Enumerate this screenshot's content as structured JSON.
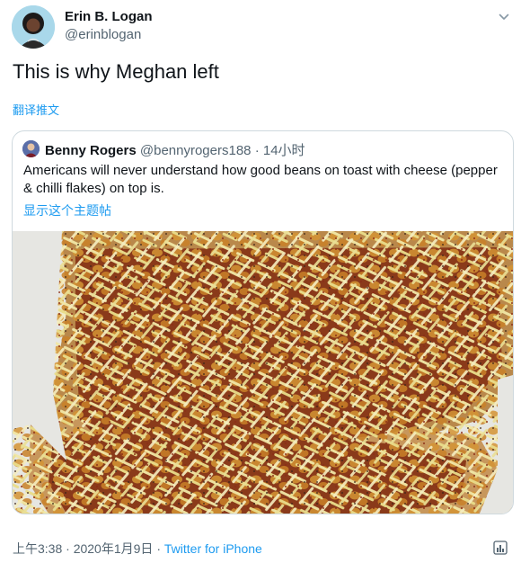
{
  "author": {
    "name": "Erin B. Logan",
    "handle": "@erinblogan"
  },
  "tweet": {
    "text": "This is why Meghan left",
    "translate_label": "翻译推文"
  },
  "quoted": {
    "name": "Benny Rogers",
    "handle": "@bennyrogers188",
    "separator": "·",
    "time": "14小时",
    "text": "Americans will never understand how good beans on toast with cheese (pepper & chilli flakes) on top is.",
    "show_thread_label": "显示这个主题帖"
  },
  "footer": {
    "time": "上午3:38",
    "separator1": "·",
    "date": "2020年1月9日",
    "separator2": "·",
    "source": "Twitter for iPhone"
  },
  "colors": {
    "link": "#1d9bf0",
    "secondary_text": "#536471",
    "border": "#cfd9de"
  },
  "icons": {
    "menu": "chevron-down-icon",
    "analytics": "analytics-icon"
  }
}
